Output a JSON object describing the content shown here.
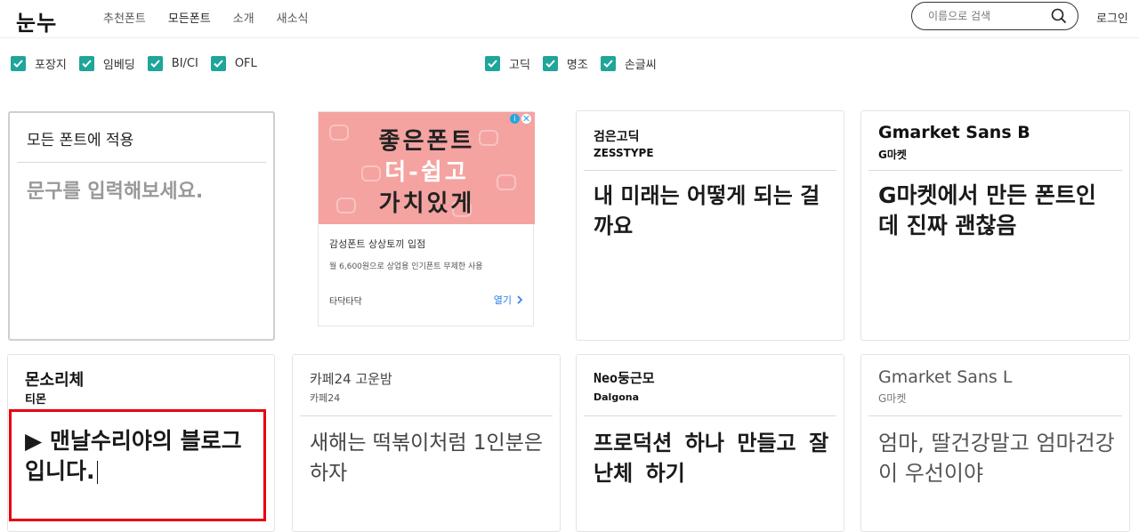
{
  "header": {
    "logo": "눈누",
    "nav": [
      {
        "label": "추천폰트",
        "active": false
      },
      {
        "label": "모든폰트",
        "active": true
      },
      {
        "label": "소개",
        "active": false
      },
      {
        "label": "새소식",
        "active": false
      }
    ],
    "search_placeholder": "이름으로 검색",
    "login": "로그인"
  },
  "filters_left": [
    {
      "label": "포장지",
      "checked": true
    },
    {
      "label": "임베딩",
      "checked": true
    },
    {
      "label": "BI/CI",
      "checked": true
    },
    {
      "label": "OFL",
      "checked": true
    }
  ],
  "filters_right": [
    {
      "label": "고딕",
      "checked": true
    },
    {
      "label": "명조",
      "checked": true
    },
    {
      "label": "손글씨",
      "checked": true
    }
  ],
  "apply_card": {
    "title": "모든 폰트에 적용",
    "placeholder": "문구를 입력해보세요."
  },
  "ad": {
    "image_lines": [
      "좋은폰트",
      "더-쉽고",
      "가치있게"
    ],
    "headline": "감성폰트 상상토끼 입점",
    "body": "월 6,600원으로 상업용 인기폰트 무제한 사용",
    "advertiser": "타닥타닥",
    "open": "열기"
  },
  "fonts": [
    {
      "name": "검은고딕",
      "author": "ZESSTYPE",
      "sample": "내 미래는 어떻게 되는 걸까요"
    },
    {
      "name": "Gmarket Sans B",
      "author": "G마켓",
      "sample": "G마켓에서 만든 폰트인데 진짜 괜찮음"
    },
    {
      "name": "몬소리체",
      "author": "티몬",
      "sample": "▶ 맨날수리야의 블로그입니다."
    },
    {
      "name": "카페24 고운밤",
      "author": "카페24",
      "sample": "새해는 떡볶이처럼 1인분은 하자"
    },
    {
      "name": "Neo둥근모",
      "author": "Dalgona",
      "sample": "프로덕션 하나 만들고 잘난체 하기"
    },
    {
      "name": "Gmarket Sans L",
      "author": "G마켓",
      "sample": "엄마, 딸건강말고 엄마건강이 우선이야"
    }
  ],
  "colors": {
    "accent": "#1fa59a",
    "highlight": "#e60012",
    "ad_bg": "#f4a3a1",
    "link": "#2b7de9"
  }
}
